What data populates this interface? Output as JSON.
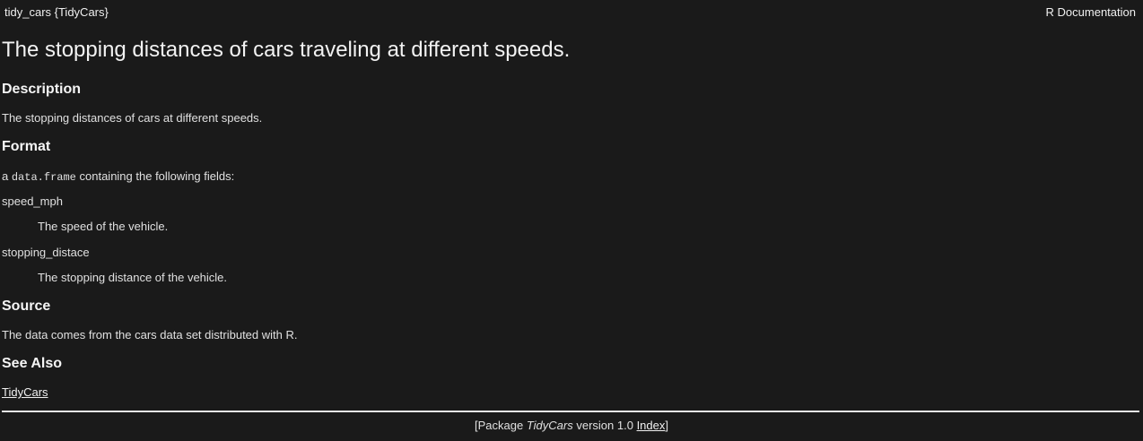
{
  "header": {
    "topic": "tidy_cars {TidyCars}",
    "doc_label": "R Documentation"
  },
  "title": "The stopping distances of cars traveling at different speeds.",
  "description": {
    "heading": "Description",
    "text": "The stopping distances of cars at different speeds."
  },
  "format": {
    "heading": "Format",
    "intro_prefix": "a",
    "intro_code": "data.frame",
    "intro_suffix": "containing the following fields:",
    "fields": [
      {
        "name": "speed_mph",
        "desc": "The speed of the vehicle."
      },
      {
        "name": "stopping_distace",
        "desc": "The stopping distance of the vehicle."
      }
    ]
  },
  "source": {
    "heading": "Source",
    "text": "The data comes from the cars data set distributed with R."
  },
  "see_also": {
    "heading": "See Also",
    "link": "TidyCars"
  },
  "footer": {
    "open_bracket": "[Package",
    "package_name": "TidyCars",
    "version_text": "version 1.0",
    "index_link": "Index",
    "close_bracket": "]"
  }
}
